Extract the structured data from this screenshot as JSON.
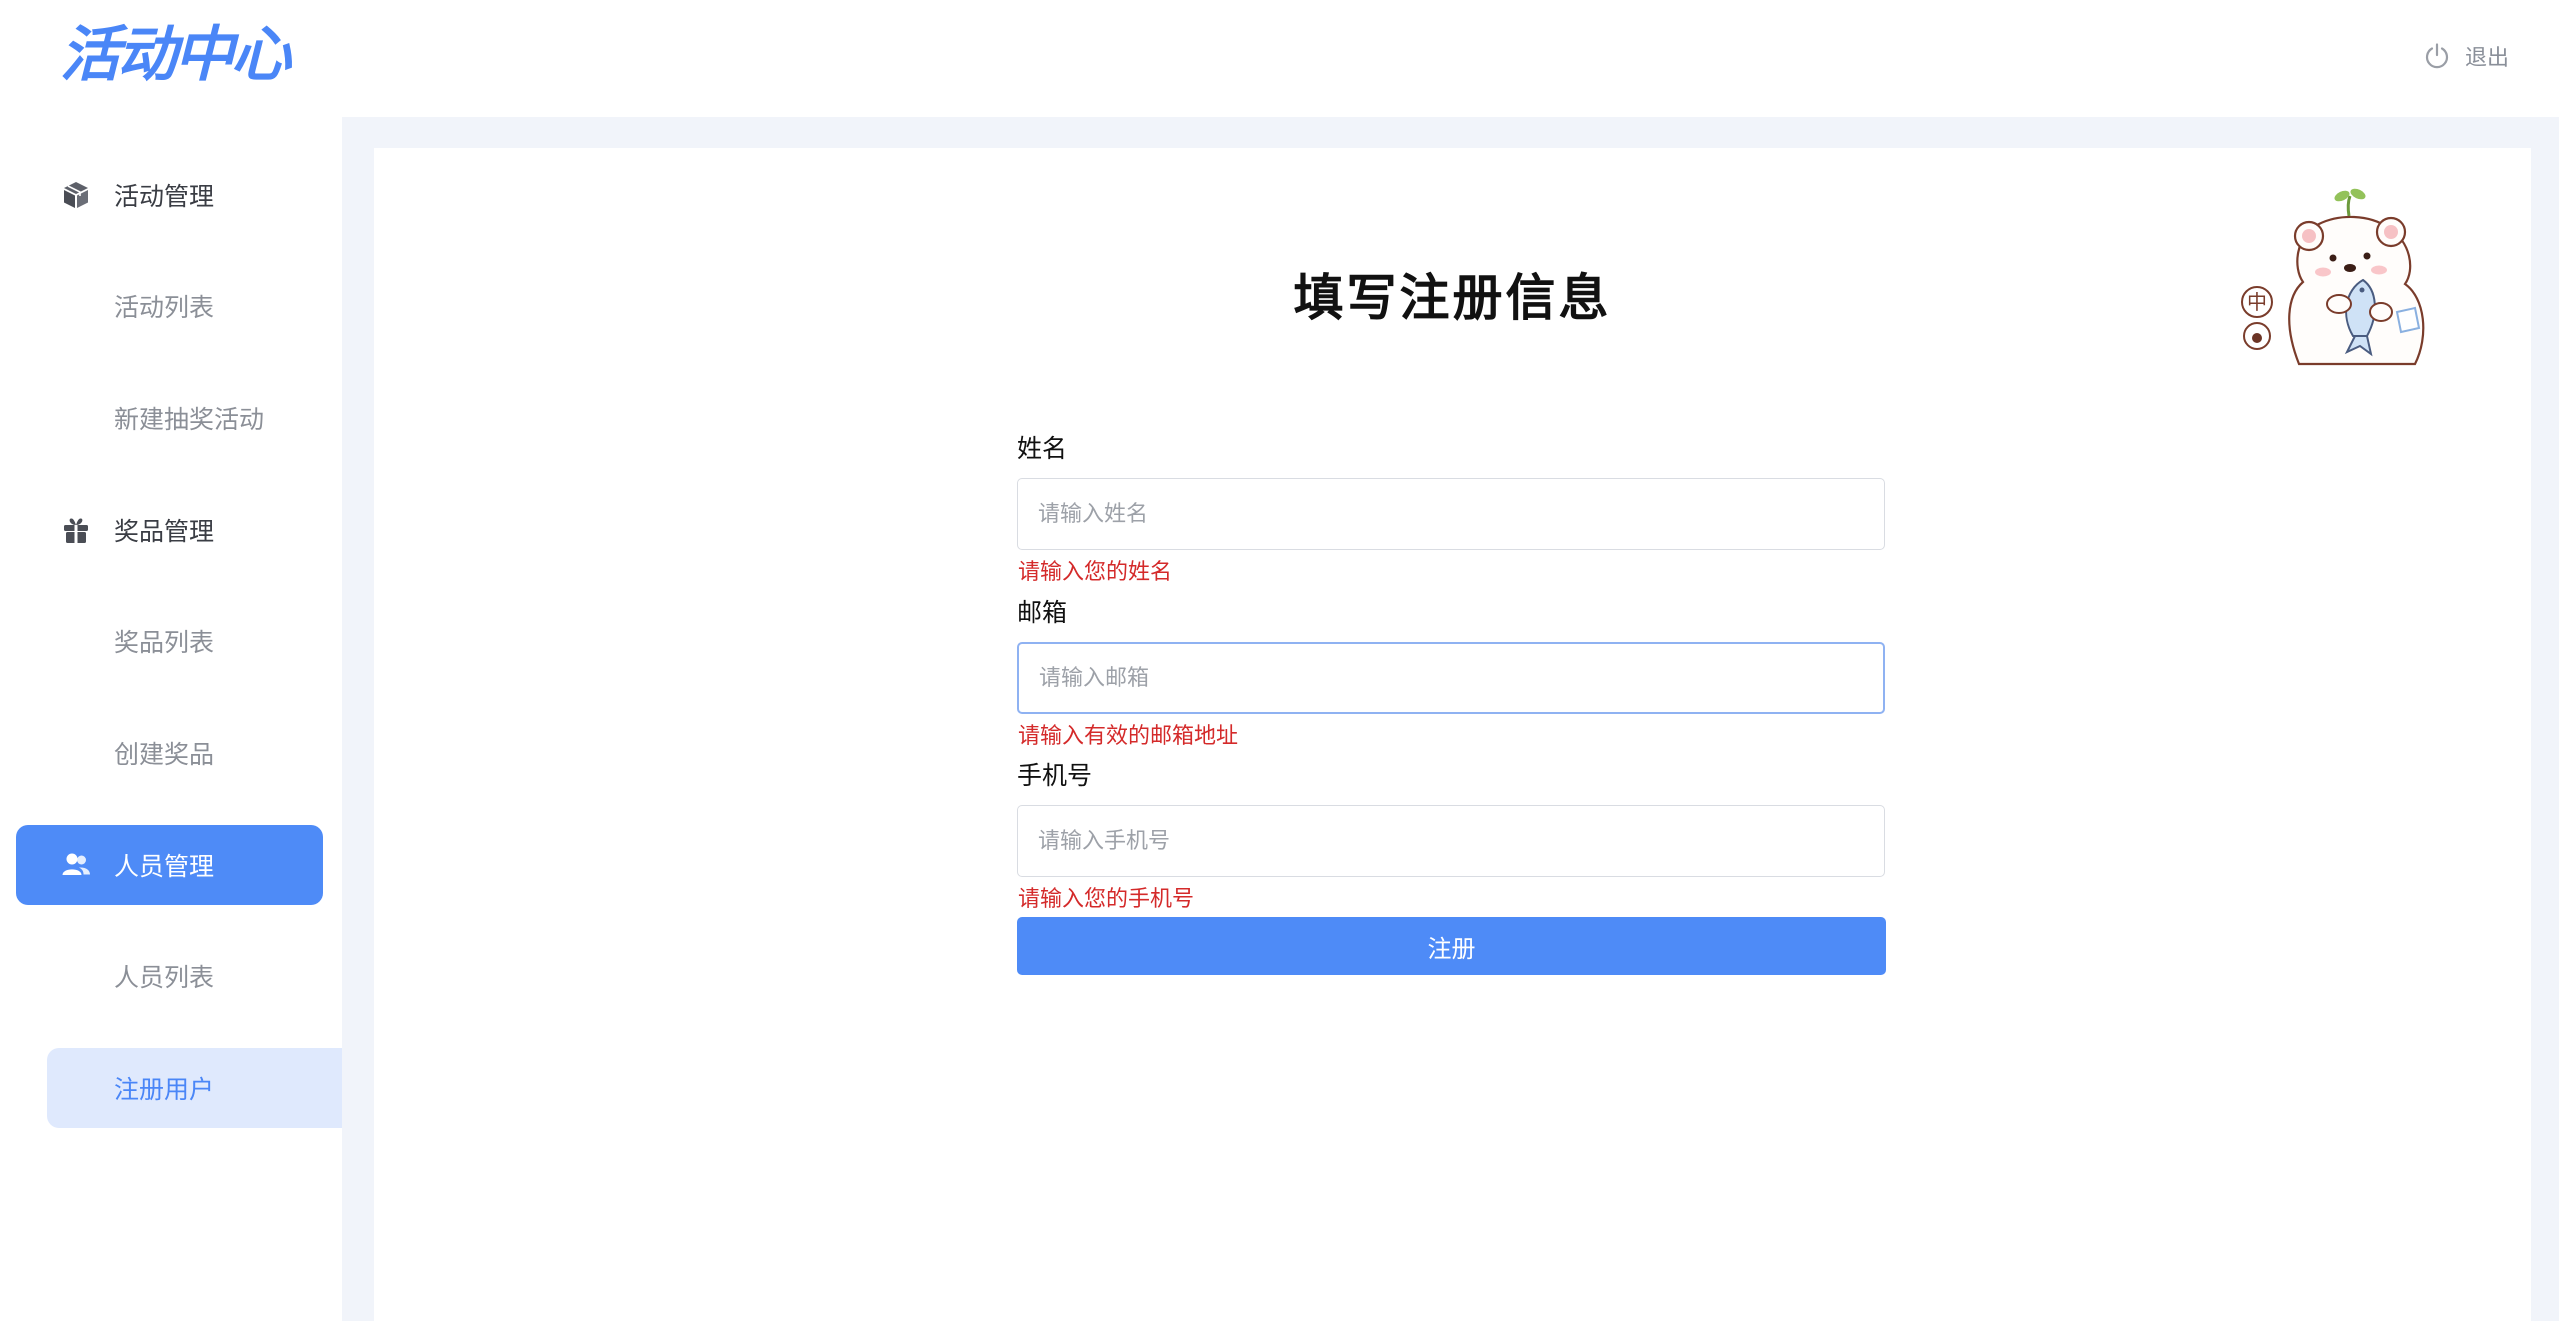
{
  "header": {
    "logo_text": "活动中心",
    "logout_label": "退出",
    "logout_icon": "power-icon"
  },
  "sidebar": {
    "groups": [
      {
        "label": "活动管理",
        "icon": "cube-icon",
        "items": [
          "活动列表",
          "新建抽奖活动"
        ]
      },
      {
        "label": "奖品管理",
        "icon": "gift-icon",
        "items": [
          "奖品列表",
          "创建奖品"
        ]
      },
      {
        "label": "人员管理",
        "icon": "users-icon",
        "items": [
          "人员列表",
          "注册用户"
        ],
        "active": true
      }
    ],
    "selected_item": "注册用户"
  },
  "form": {
    "title": "填写注册信息",
    "name": {
      "label": "姓名",
      "placeholder": "请输入姓名",
      "value": "",
      "error": "请输入您的姓名"
    },
    "email": {
      "label": "邮箱",
      "placeholder": "请输入邮箱",
      "value": "",
      "error": "请输入有效的邮箱地址"
    },
    "phone": {
      "label": "手机号",
      "placeholder": "请输入手机号",
      "value": "",
      "error": "请输入您的手机号"
    },
    "submit_label": "注册"
  },
  "mascot": {
    "badge_text": "中"
  },
  "colors": {
    "accent": "#4e8bf7",
    "error": "#d42a2a",
    "content_bg": "#f1f4fa",
    "selected_bg": "#dfe9fd"
  }
}
